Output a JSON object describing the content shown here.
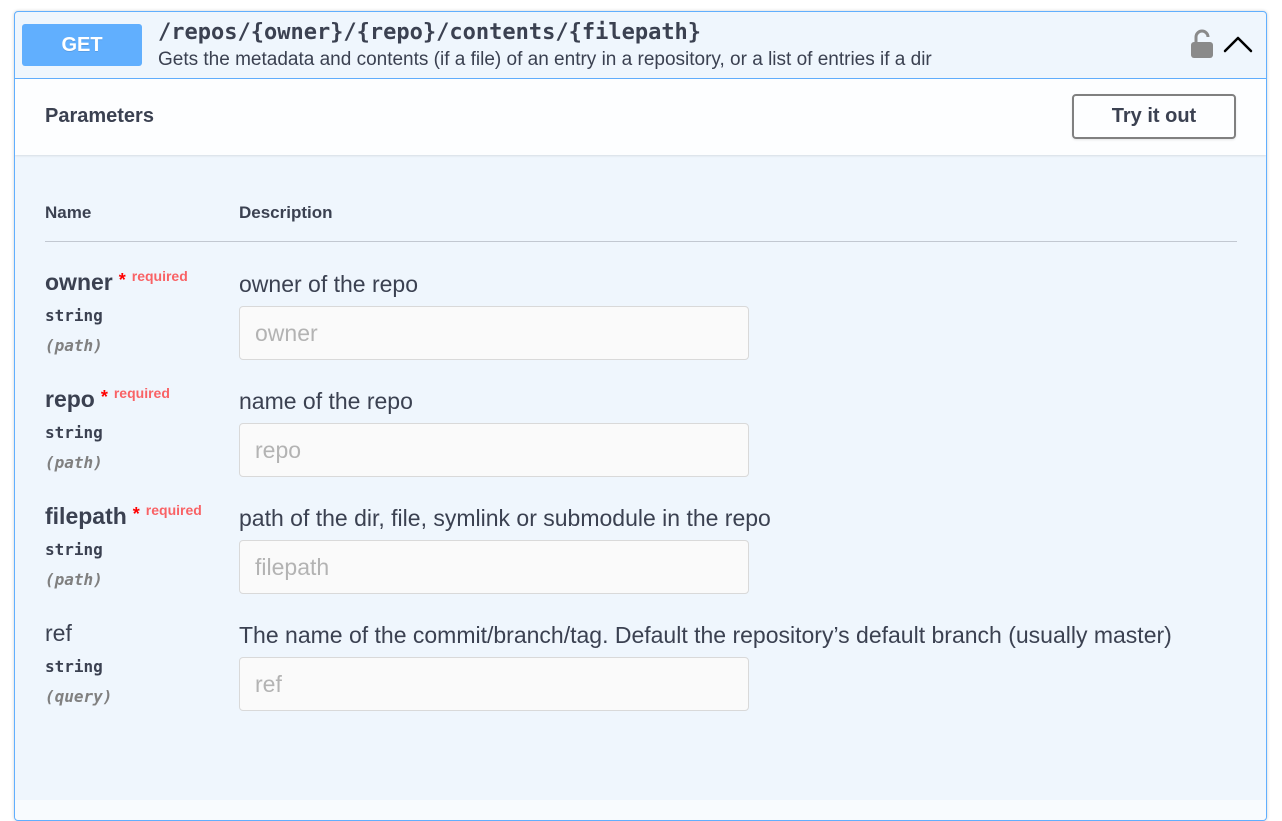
{
  "operation": {
    "method": "GET",
    "path": "/repos/{owner}/{repo}/contents/{filepath}",
    "description": "Gets the metadata and contents (if a file) of an entry in a repository, or a list of entries if a dir",
    "lock_icon": "unlocked-padlock-icon",
    "collapse_icon": "chevron-up-icon",
    "method_color": "#61affe"
  },
  "parameters_section": {
    "title": "Parameters",
    "try_it_out_label": "Try it out",
    "columns": {
      "name": "Name",
      "description": "Description"
    },
    "params": [
      {
        "name": "owner",
        "star": "*",
        "required_label": "required",
        "type": "string",
        "in": "(path)",
        "description": "owner of the repo",
        "placeholder": "owner"
      },
      {
        "name": "repo",
        "star": "*",
        "required_label": "required",
        "type": "string",
        "in": "(path)",
        "description": "name of the repo",
        "placeholder": "repo"
      },
      {
        "name": "filepath",
        "star": "*",
        "required_label": "required",
        "type": "string",
        "in": "(path)",
        "description": "path of the dir, file, symlink or submodule in the repo",
        "placeholder": "filepath"
      },
      {
        "name": "ref",
        "type": "string",
        "in": "(query)",
        "description": "The name of the commit/branch/tag. Default the repository’s default branch (usually master)",
        "placeholder": "ref"
      }
    ]
  }
}
